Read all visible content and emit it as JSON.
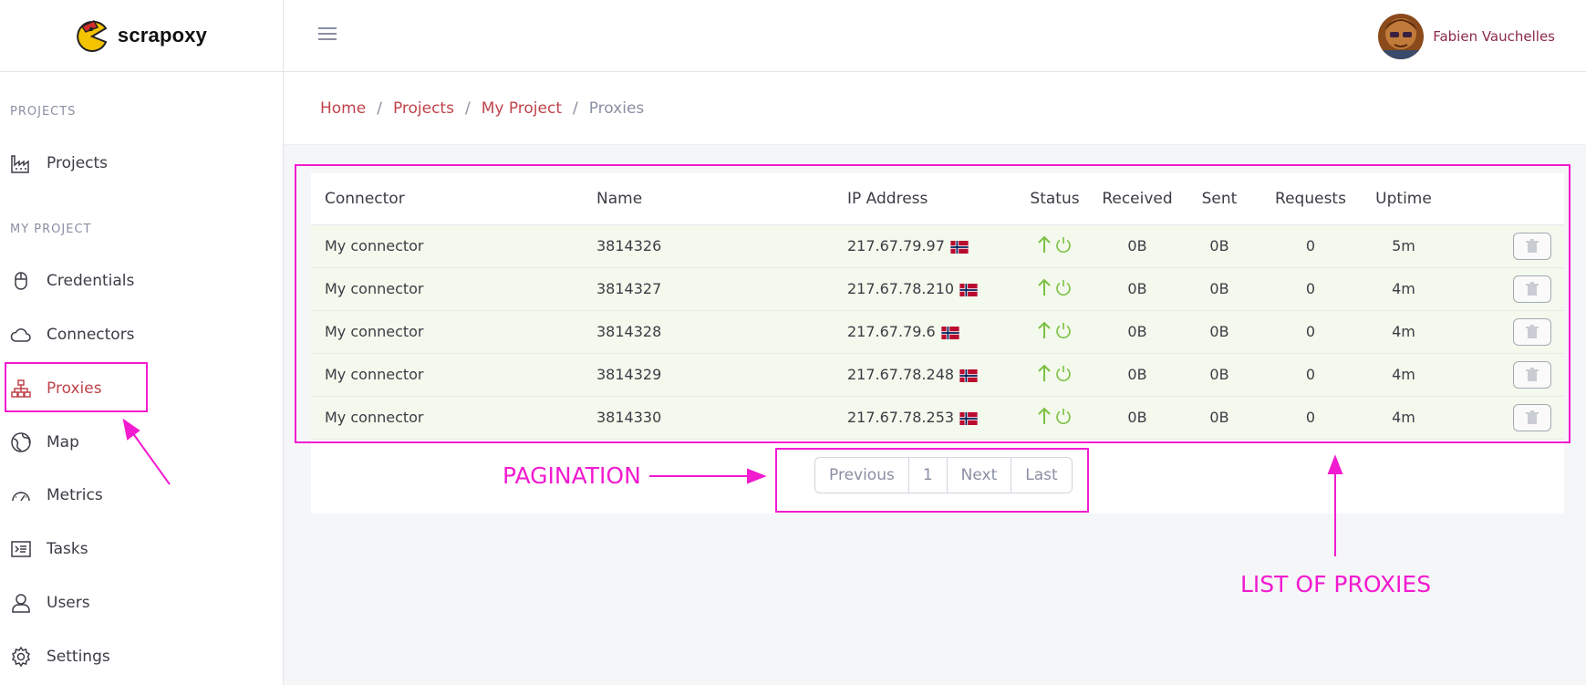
{
  "brand": {
    "name": "scrapoxy"
  },
  "sidebar": {
    "section_projects": "PROJECTS",
    "section_my_project": "MY PROJECT",
    "items": [
      {
        "label": "Projects",
        "icon": "factory-icon"
      },
      {
        "label": "Credentials",
        "icon": "mouse-icon"
      },
      {
        "label": "Connectors",
        "icon": "cloud-icon"
      },
      {
        "label": "Proxies",
        "icon": "sitemap-icon",
        "active": true
      },
      {
        "label": "Map",
        "icon": "globe-icon"
      },
      {
        "label": "Metrics",
        "icon": "gauge-icon"
      },
      {
        "label": "Tasks",
        "icon": "terminal-icon"
      },
      {
        "label": "Users",
        "icon": "user-icon"
      },
      {
        "label": "Settings",
        "icon": "gear-icon"
      }
    ]
  },
  "header": {
    "user_name": "Fabien Vauchelles"
  },
  "breadcrumb": [
    "Home",
    "Projects",
    "My Project",
    "Proxies"
  ],
  "table": {
    "headers": [
      "Connector",
      "Name",
      "IP Address",
      "Status",
      "Received",
      "Sent",
      "Requests",
      "Uptime"
    ],
    "rows": [
      {
        "connector": "My connector",
        "name": "3814326",
        "ip": "217.67.79.97",
        "received": "0B",
        "sent": "0B",
        "requests": "0",
        "uptime": "5m"
      },
      {
        "connector": "My connector",
        "name": "3814327",
        "ip": "217.67.78.210",
        "received": "0B",
        "sent": "0B",
        "requests": "0",
        "uptime": "4m"
      },
      {
        "connector": "My connector",
        "name": "3814328",
        "ip": "217.67.79.6",
        "received": "0B",
        "sent": "0B",
        "requests": "0",
        "uptime": "4m"
      },
      {
        "connector": "My connector",
        "name": "3814329",
        "ip": "217.67.78.248",
        "received": "0B",
        "sent": "0B",
        "requests": "0",
        "uptime": "4m"
      },
      {
        "connector": "My connector",
        "name": "3814330",
        "ip": "217.67.78.253",
        "received": "0B",
        "sent": "0B",
        "requests": "0",
        "uptime": "4m"
      }
    ]
  },
  "pagination": {
    "previous": "Previous",
    "page": "1",
    "next": "Next",
    "last": "Last"
  },
  "annotations": {
    "pagination": "PAGINATION",
    "list": "LIST OF PROXIES"
  },
  "colors": {
    "accent": "#c0434b",
    "annotation": "#f21bd0",
    "status_green": "#7cc043",
    "row_bg": "#f3f9ec"
  }
}
